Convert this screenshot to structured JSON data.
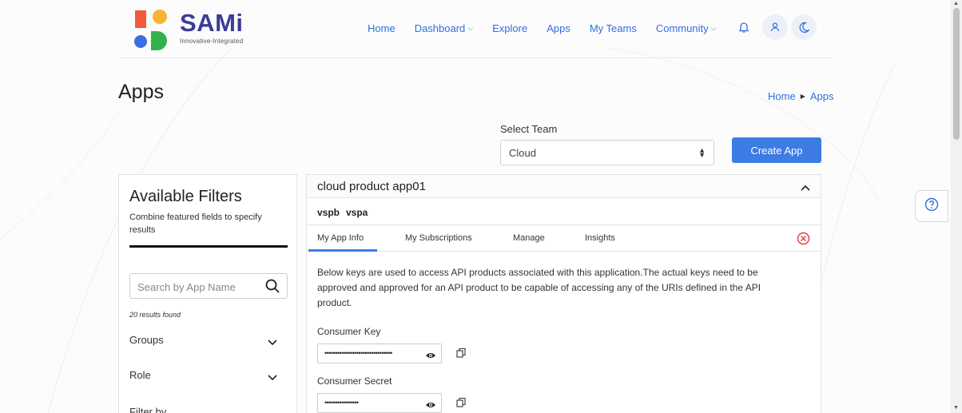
{
  "brand": {
    "name": "SAMi",
    "tagline": "Innovative-Integrated"
  },
  "nav": {
    "items": [
      {
        "label": "Home",
        "dropdown": false
      },
      {
        "label": "Dashboard",
        "dropdown": true
      },
      {
        "label": "Explore",
        "dropdown": false
      },
      {
        "label": "Apps",
        "dropdown": false
      },
      {
        "label": "My Teams",
        "dropdown": false
      },
      {
        "label": "Community",
        "dropdown": true
      }
    ],
    "icons": [
      "bell-icon",
      "user-icon",
      "moon-icon"
    ]
  },
  "page": {
    "title": "Apps"
  },
  "breadcrumb": {
    "home": "Home",
    "current": "Apps"
  },
  "team_select": {
    "label": "Select Team",
    "value": "Cloud"
  },
  "create_app_label": "Create App",
  "filters": {
    "title": "Available Filters",
    "subtitle": "Combine featured fields to specify results",
    "search_placeholder": "Search by App Name",
    "results": "20 results found",
    "groups": [
      {
        "label": "Groups"
      },
      {
        "label": "Role"
      },
      {
        "label": "Filter by"
      }
    ]
  },
  "app": {
    "name": "cloud product app01",
    "teams": [
      "vspb",
      "vspa"
    ],
    "tabs": [
      {
        "label": "My App Info",
        "active": true
      },
      {
        "label": "My Subscriptions",
        "active": false
      },
      {
        "label": "Manage",
        "active": false
      },
      {
        "label": "Insights",
        "active": false
      }
    ],
    "description": "Below keys are used to access API products associated with this application.The actual keys need to be approved and approved for an API product to be capable of accessing any of the URIs defined in the API product.",
    "consumer_key_label": "Consumer Key",
    "consumer_key_masked": "••••••••••••••••••••••••••••••••",
    "consumer_secret_label": "Consumer Secret",
    "consumer_secret_masked": "••••••••••••••••"
  },
  "colors": {
    "accent": "#3d7be5",
    "brand_text": "#3b3b9a",
    "close_red": "#e53935"
  }
}
